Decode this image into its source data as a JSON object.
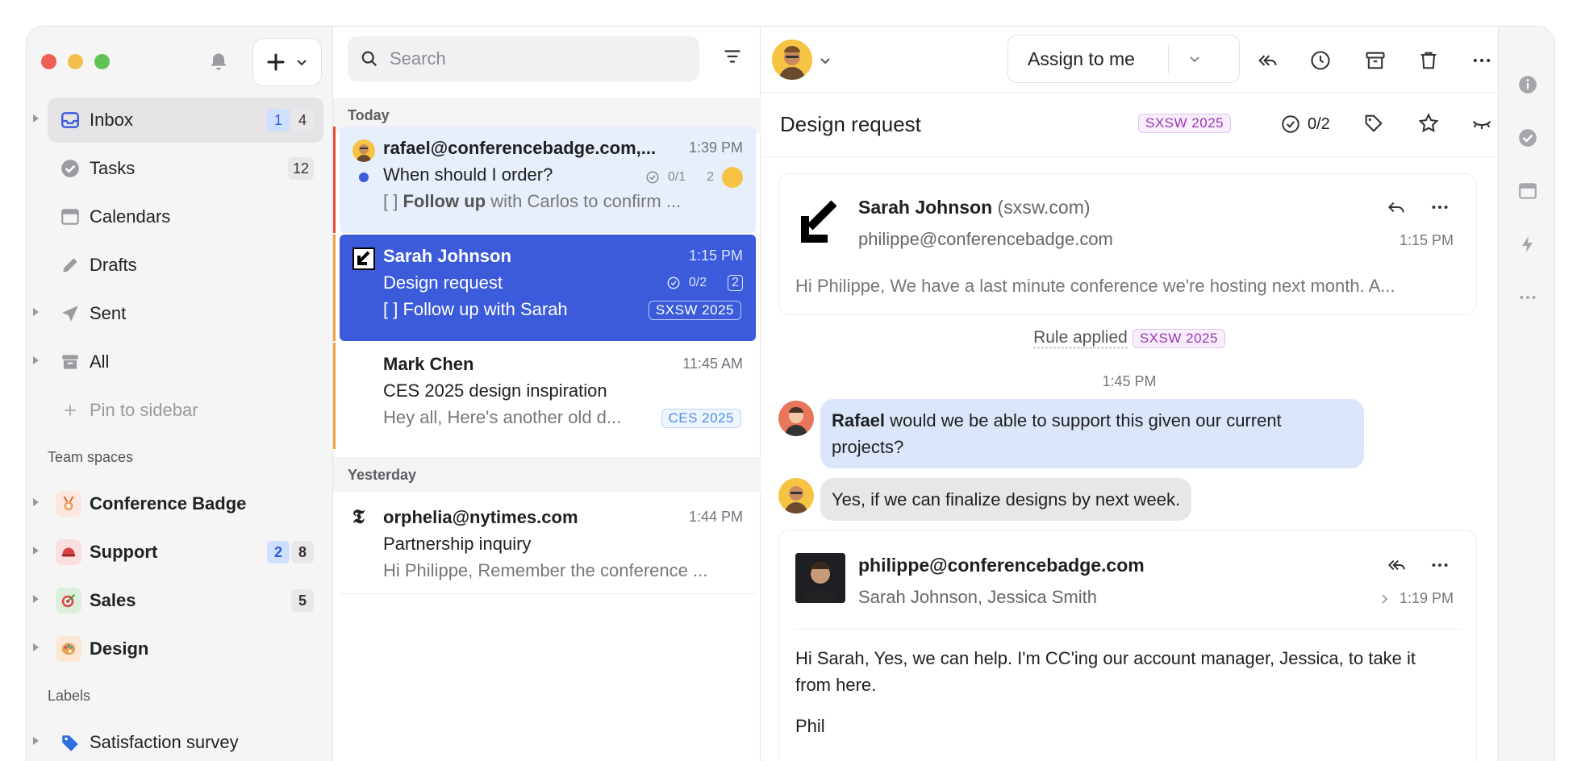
{
  "sidebar": {
    "nav": [
      {
        "label": "Inbox",
        "count_unread": "1",
        "count_total": "4"
      },
      {
        "label": "Tasks",
        "count": "12"
      },
      {
        "label": "Calendars"
      },
      {
        "label": "Drafts"
      },
      {
        "label": "Sent"
      },
      {
        "label": "All"
      },
      {
        "label": "Pin to sidebar"
      }
    ],
    "team_spaces_title": "Team spaces",
    "teams": [
      {
        "label": "Conference Badge"
      },
      {
        "label": "Support",
        "count_unread": "2",
        "count_total": "8"
      },
      {
        "label": "Sales",
        "count": "5"
      },
      {
        "label": "Design"
      }
    ],
    "labels_title": "Labels",
    "labels": [
      {
        "label": "Satisfaction survey"
      }
    ]
  },
  "list": {
    "search_placeholder": "Search",
    "today_label": "Today",
    "yesterday_label": "Yesterday",
    "messages": [
      {
        "from": "rafael@conferencebadge.com,...",
        "time": "1:39 PM",
        "subject": "When should I order?",
        "tasks": "0/1",
        "count": "2",
        "preview_prefix": "[ ] ",
        "preview_bold": "Follow up",
        "preview_rest": " with Carlos to confirm ..."
      },
      {
        "from": "Sarah Johnson",
        "time": "1:15 PM",
        "subject": "Design request",
        "tasks": "0/2",
        "count": "2",
        "preview": "[ ] Follow up with Sarah",
        "tag": "SXSW 2025"
      },
      {
        "from": "Mark Chen",
        "time": "11:45 AM",
        "subject": "CES 2025 design inspiration",
        "preview": "Hey all, Here's another old d...",
        "tag": "CES 2025"
      },
      {
        "from": "orphelia@nytimes.com",
        "time": "1:44 PM",
        "subject": "Partnership inquiry",
        "preview": "Hi Philippe, Remember the conference ..."
      }
    ]
  },
  "reader": {
    "assign_label": "Assign to me",
    "subject": "Design request",
    "tag": "SXSW 2025",
    "tasks": "0/2",
    "email1": {
      "sender": "Sarah Johnson",
      "sender_domain": "(sxsw.com)",
      "to": "philippe@conferencebadge.com",
      "time": "1:15 PM",
      "preview": "Hi Philippe, We have a last minute conference we're hosting next month. A..."
    },
    "rule_text": "Rule applied",
    "rule_tag": "SXSW 2025",
    "chat_time": "1:45 PM",
    "chat1_name": "Rafael",
    "chat1_text": " would we be able to support this given our current projects?",
    "chat2_text": "Yes, if we can finalize designs by next week.",
    "email2": {
      "sender": "philippe@conferencebadge.com",
      "to": "Sarah Johnson, Jessica Smith",
      "time": "1:19 PM",
      "body": "Hi Sarah, Yes, we can help. I'm CC'ing our account manager, Jessica, to take it from here.",
      "signoff": "Phil"
    }
  },
  "colors": {
    "accent": "#3b5bdb",
    "selected_row": "#3b5bdb",
    "tag_purple": "#9c36b5",
    "tag_blue": "#4c8ee6"
  }
}
